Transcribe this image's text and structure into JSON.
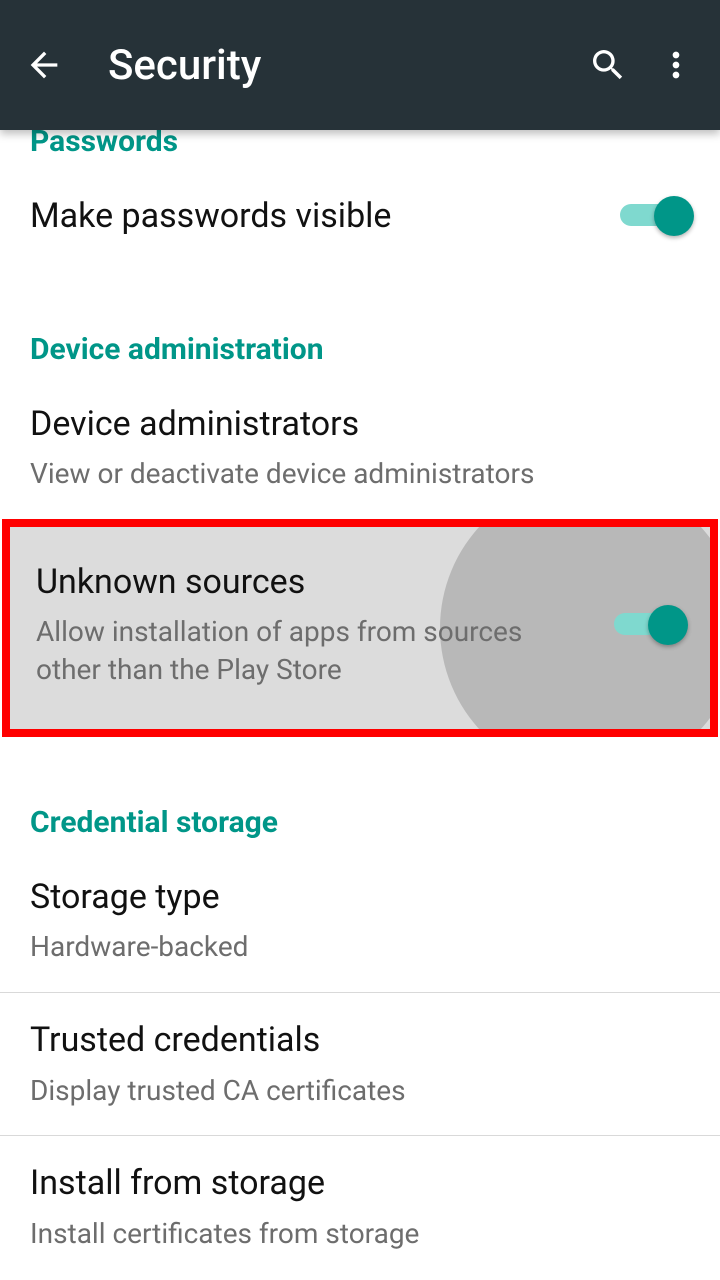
{
  "appbar": {
    "title": "Security"
  },
  "sections": {
    "passwords": {
      "header": "Passwords",
      "make_visible": {
        "title": "Make passwords visible"
      }
    },
    "device_admin": {
      "header": "Device administration",
      "administrators": {
        "title": "Device administrators",
        "subtitle": "View or deactivate device administrators"
      },
      "unknown_sources": {
        "title": "Unknown sources",
        "subtitle": "Allow installation of apps from sources other than the Play Store"
      }
    },
    "credential_storage": {
      "header": "Credential storage",
      "storage_type": {
        "title": "Storage type",
        "subtitle": "Hardware-backed"
      },
      "trusted": {
        "title": "Trusted credentials",
        "subtitle": "Display trusted CA certificates"
      },
      "install": {
        "title": "Install from storage",
        "subtitle": "Install certificates from storage"
      }
    }
  },
  "toggles": {
    "make_passwords_visible": true,
    "unknown_sources": true
  },
  "colors": {
    "accent": "#009688",
    "appbar_bg": "#263238",
    "highlight_border": "#ff0000"
  }
}
